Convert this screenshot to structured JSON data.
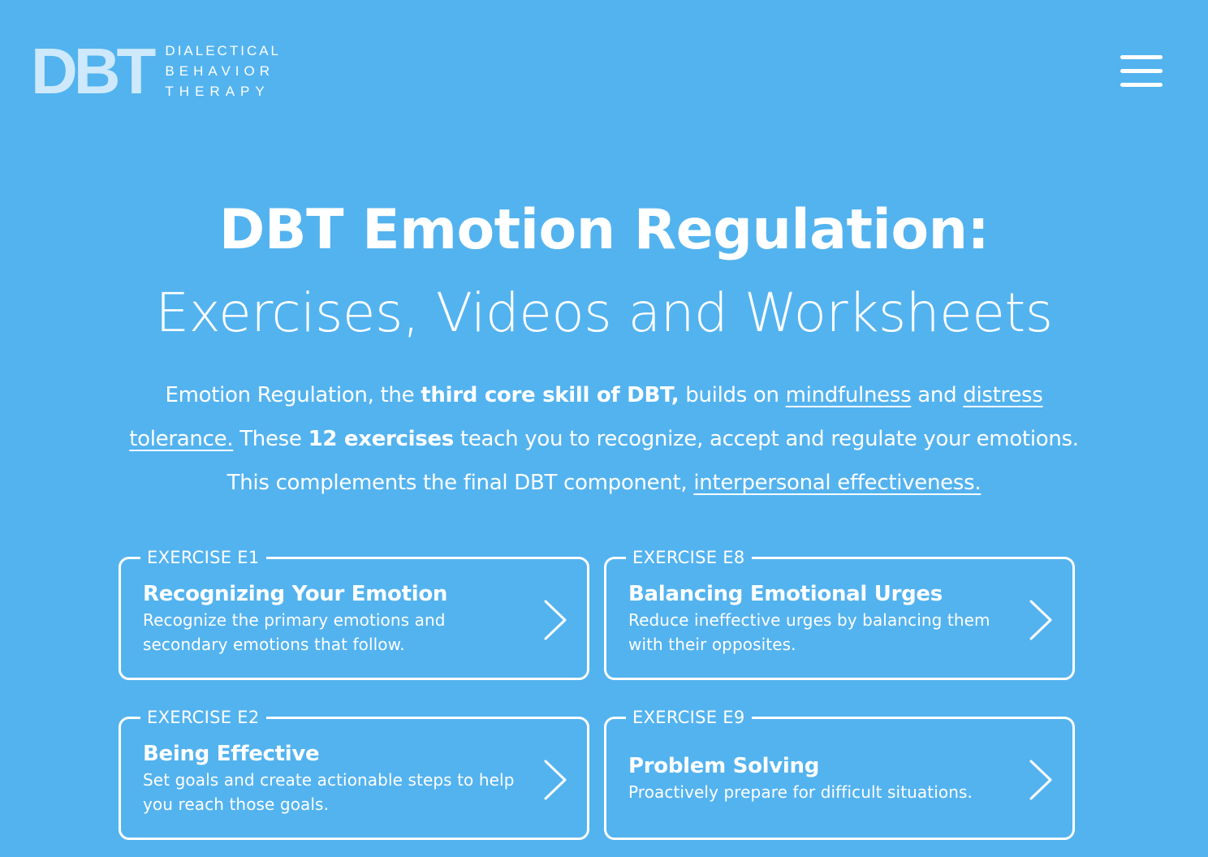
{
  "header": {
    "logo": {
      "mark": "DBT",
      "line1": "DIALECTICAL",
      "line2": "BEHAVIOR",
      "line3": "THERAPY"
    },
    "menu_icon": "hamburger-menu-icon"
  },
  "hero": {
    "title": "DBT Emotion Regulation:",
    "subtitle": "Exercises, Videos and Worksheets"
  },
  "intro": {
    "t1": "Emotion Regulation, the ",
    "b1": "third core skill of DBT,",
    "t2": " builds on ",
    "link_mindfulness": "mindfulness",
    "t3": " and ",
    "link_distress": "distress tolerance.",
    "t4": " These ",
    "b2": "12 exercises",
    "t5": " teach you to recognize, accept and regulate your emotions. This complements the final DBT component, ",
    "link_interpersonal": "interpersonal effectiveness."
  },
  "cards": [
    {
      "tag": "EXERCISE E1",
      "title": "Recognizing Your Emotion",
      "desc": "Recognize the primary emotions and secondary emotions that follow."
    },
    {
      "tag": "EXERCISE E8",
      "title": "Balancing Emotional Urges",
      "desc": "Reduce ineffective urges by balancing them with their opposites."
    },
    {
      "tag": "EXERCISE E2",
      "title": "Being Effective",
      "desc": "Set goals and create actionable steps to help you reach those goals."
    },
    {
      "tag": "EXERCISE E9",
      "title": "Problem Solving",
      "desc": "Proactively prepare for difficult situations."
    }
  ],
  "chevron_icon": "chevron-right-icon",
  "colors": {
    "background": "#53b3ef",
    "text": "#ffffff",
    "logo_mark": "#cde9fb"
  }
}
